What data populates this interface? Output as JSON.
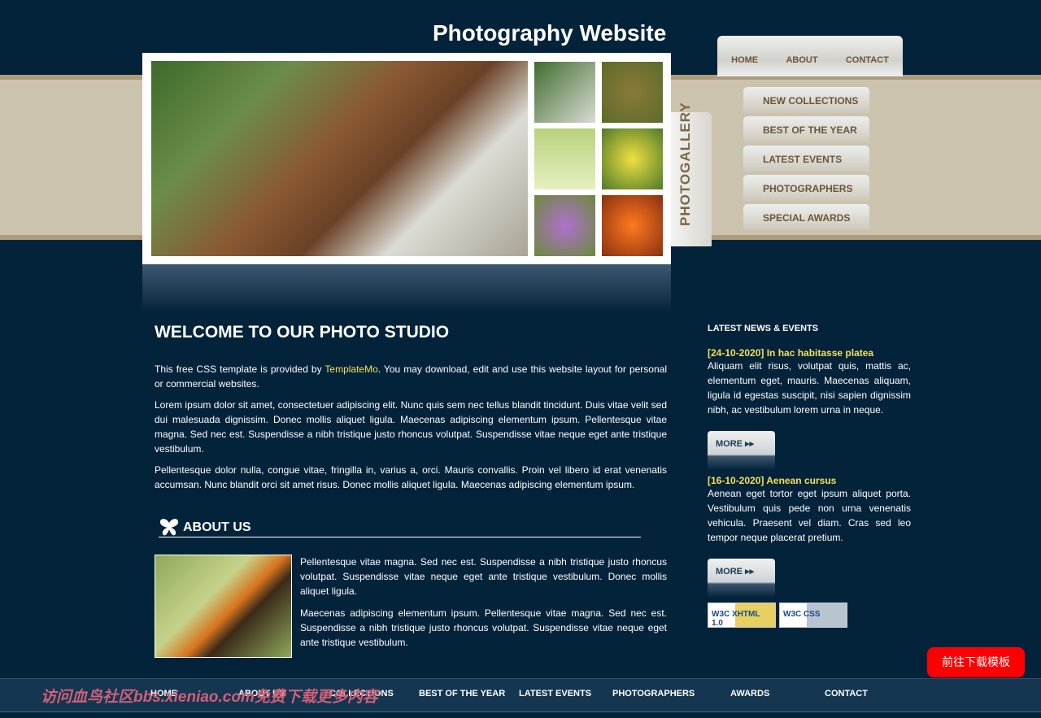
{
  "site_title": "Photography Website",
  "top_nav": [
    "HOME",
    "ABOUT",
    "CONTACT"
  ],
  "side_nav": [
    "NEW COLLECTIONS",
    "BEST OF THE YEAR",
    "LATEST EVENTS",
    "PHOTOGRAPHERS",
    "SPECIAL AWARDS"
  ],
  "gallery_tab": "PHOTOGALLERY",
  "welcome": {
    "title": "WELCOME TO OUR PHOTO STUDIO",
    "p1_before": "This free CSS template is provided by ",
    "p1_link": "TemplateMo",
    "p1_after": ". You may download, edit and use this website layout for personal or commercial websites.",
    "p2": "Lorem ipsum dolor sit amet, consectetuer adipiscing elit. Nunc quis sem nec tellus blandit tincidunt. Duis vitae velit sed dui malesuada dignissim. Donec mollis aliquet ligula. Maecenas adipiscing elementum ipsum. Pellentesque vitae magna. Sed nec est. Suspendisse a nibh tristique justo rhoncus volutpat. Suspendisse vitae neque eget ante tristique vestibulum.",
    "p3": "Pellentesque dolor nulla, congue vitae, fringilla in, varius a, orci. Mauris convallis. Proin vel libero id erat venenatis accumsan. Nunc blandit orci sit amet risus. Donec mollis aliquet ligula. Maecenas adipiscing elementum ipsum."
  },
  "about": {
    "title": "ABOUT US",
    "p1": "Pellentesque vitae magna. Sed nec est. Suspendisse a nibh tristique justo rhoncus volutpat. Suspendisse vitae neque eget ante tristique vestibulum. Donec mollis aliquet ligula.",
    "p2": "Maecenas adipiscing elementum ipsum. Pellentesque vitae magna. Sed nec est. Suspendisse a nibh tristique justo rhoncus volutpat. Suspendisse vitae neque eget ante tristique vestibulum."
  },
  "news": {
    "title": "LATEST NEWS & EVENTS",
    "items": [
      {
        "date": "[24-10-2020] In hac habitasse platea",
        "text": "Aliquam elit risus, volutpat quis, mattis ac, elementum eget, mauris. Maecenas aliquam, ligula id egestas suscipit, nisi sapien dignissim nibh, ac vestibulum lorem urna in neque.",
        "more": "MORE"
      },
      {
        "date": "[16-10-2020] Aenean cursus",
        "text": "Aenean eget tortor eget ipsum aliquet porta. Vestibulum quis pede non urna venenatis vehicula. Praesent vel diam. Cras sed leo tempor neque placerat pretium.",
        "more": "MORE"
      }
    ],
    "badges": [
      "W3C XHTML 1.0",
      "W3C CSS"
    ]
  },
  "footer_nav": [
    "HOME",
    "ABOUT US",
    "COLLECTIONS",
    "BEST OF THE YEAR",
    "LATEST EVENTS",
    "PHOTOGRAPHERS",
    "AWARDS",
    "CONTACT"
  ],
  "watermark": "访问血鸟社区bbs.xieniao.com免费下载更多内容",
  "download_button": "前往下载模板"
}
